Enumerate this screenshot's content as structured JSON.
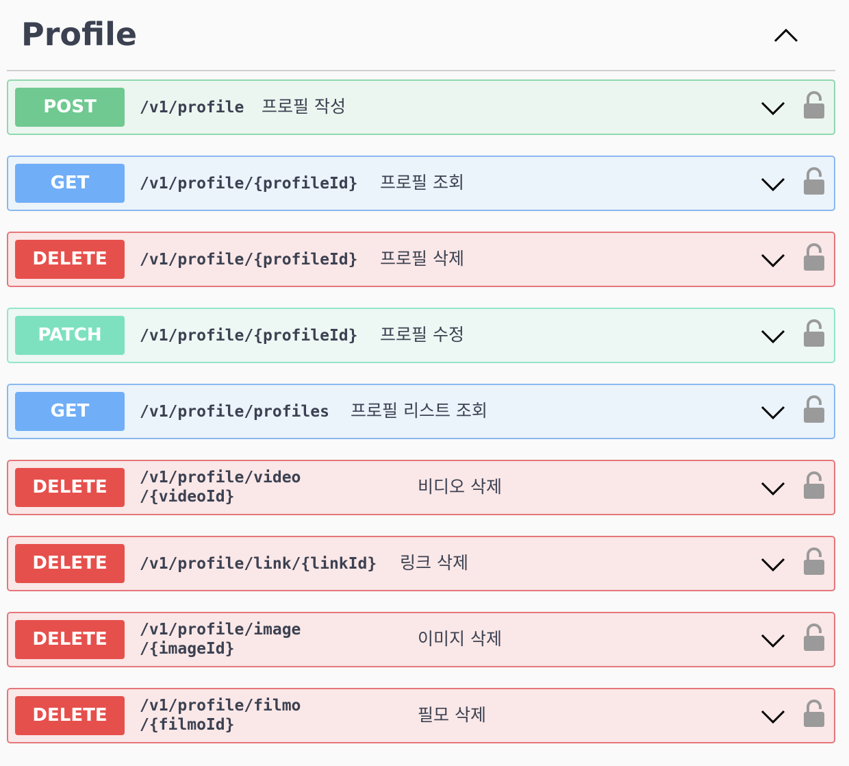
{
  "section": {
    "title": "Profile"
  },
  "operations": [
    {
      "method": "POST",
      "path": "/v1/profile",
      "summary": "프로필 작성"
    },
    {
      "method": "GET",
      "path": "/v1/profile/{profileId}",
      "summary": "프로필 조회"
    },
    {
      "method": "DELETE",
      "path": "/v1/profile/{profileId}",
      "summary": "프로필 삭제"
    },
    {
      "method": "PATCH",
      "path": "/v1/profile/{profileId}",
      "summary": "프로필 수정"
    },
    {
      "method": "GET",
      "path": "/v1/profile/profiles",
      "summary": "프로필 리스트 조회"
    },
    {
      "method": "DELETE",
      "path_line1": "/v1/profile/video",
      "path_line2": "/{videoId}",
      "summary": "비디오 삭제"
    },
    {
      "method": "DELETE",
      "path": "/v1/profile/link/{linkId}",
      "summary": "링크 삭제"
    },
    {
      "method": "DELETE",
      "path_line1": "/v1/profile/image",
      "path_line2": "/{imageId}",
      "summary": "이미지 삭제"
    },
    {
      "method": "DELETE",
      "path_line1": "/v1/profile/filmo",
      "path_line2": "/{filmoId}",
      "summary": "필모 삭제"
    }
  ],
  "icons": {
    "collapse": "chevron-up-icon",
    "expand": "chevron-down-icon",
    "auth": "lock-icon"
  },
  "colors": {
    "post": "#6fc991",
    "get": "#70aef7",
    "delete": "#e6504c",
    "patch": "#7de1c0",
    "text": "#3b4151",
    "lock": "#9a9a9a"
  }
}
